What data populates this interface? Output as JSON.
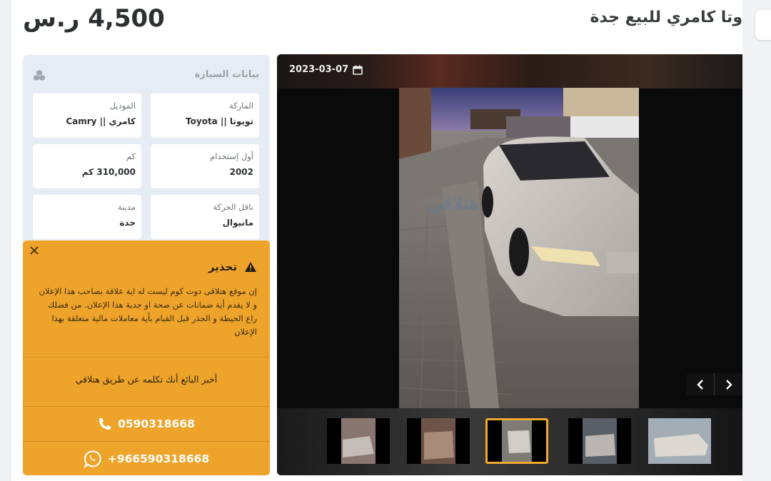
{
  "listing": {
    "title": "وتا كامري للبيع جدة",
    "price": "4,500 ر.س"
  },
  "specs": {
    "heading": "بيانات السيارة",
    "items": [
      {
        "label": "الماركة",
        "value": "تويوتا || Toyota"
      },
      {
        "label": "الموديل",
        "value": "كامري || Camry"
      },
      {
        "label": "أول إستخدام",
        "value": "2002"
      },
      {
        "label": "كم",
        "value": "310,000 كم"
      },
      {
        "label": "ناقل الحركة",
        "value": "مانيوال"
      },
      {
        "label": "مدينة",
        "value": "جدة"
      }
    ]
  },
  "warning": {
    "title": "تحذير",
    "body": "إن موقع هتلاقى دوت كوم ليست له اية علاقة بصاحب هذا الإعلان و لا يقدم أية ضمانات عن صحة او جدية هذا الإعلان. من فضلك راع الحيطة و الحذر قبل القيام بأية معاملات مالية متعلقة بهذا الإعلان",
    "tell_seller": "أخبر البائع أنك تكلمه عن طريق هتلاقي",
    "phone": "0590318668",
    "whatsapp": "+966590318668"
  },
  "gallery": {
    "date": "2023-03-07",
    "thumbnail_count": 5,
    "active_thumbnail": 3
  },
  "colors": {
    "warning_bg": "#eea42b",
    "specs_bg": "#e6ecf4",
    "active_thumb_border": "#f0a830"
  }
}
